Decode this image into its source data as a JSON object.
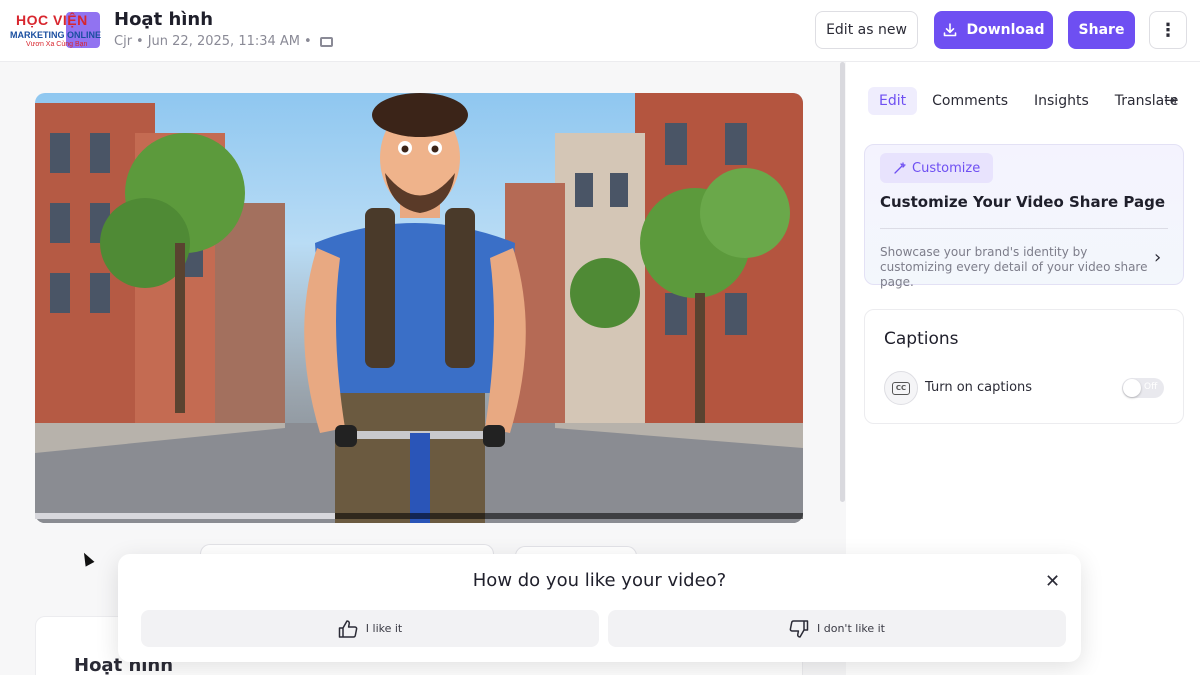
{
  "header": {
    "logo": {
      "line1": "HỌC VIỆN",
      "line2": "MARKETING ONLINE",
      "line3": "Vươn Xa Cùng Bạn"
    },
    "title": "Hoạt hình",
    "author": "Cjr",
    "date": "Jun 22, 2025, 11:34 AM",
    "edit_as_new": "Edit as new",
    "download": "Download",
    "share": "Share",
    "more_icon": "more-vertical-icon"
  },
  "video": {
    "progress_fraction": 0.39
  },
  "main": {
    "card_title": "Hoạt hình"
  },
  "panel": {
    "tabs": [
      {
        "label": "Edit",
        "active": true
      },
      {
        "label": "Comments",
        "active": false
      },
      {
        "label": "Insights",
        "active": false
      },
      {
        "label": "Translate",
        "active": false
      }
    ],
    "customize": {
      "badge": "Customize",
      "title": "Customize Your Video Share Page",
      "description": "Showcase your brand's identity by customizing every detail of your video share page."
    },
    "captions": {
      "title": "Captions",
      "label": "Turn on captions",
      "toggle_text": "Off",
      "enabled": false
    }
  },
  "feedback": {
    "question": "How do you like your video?",
    "like": "I like it",
    "dislike": "I don't like it"
  },
  "colors": {
    "accent": "#6e4ff2",
    "accent_soft": "#efedfd"
  }
}
